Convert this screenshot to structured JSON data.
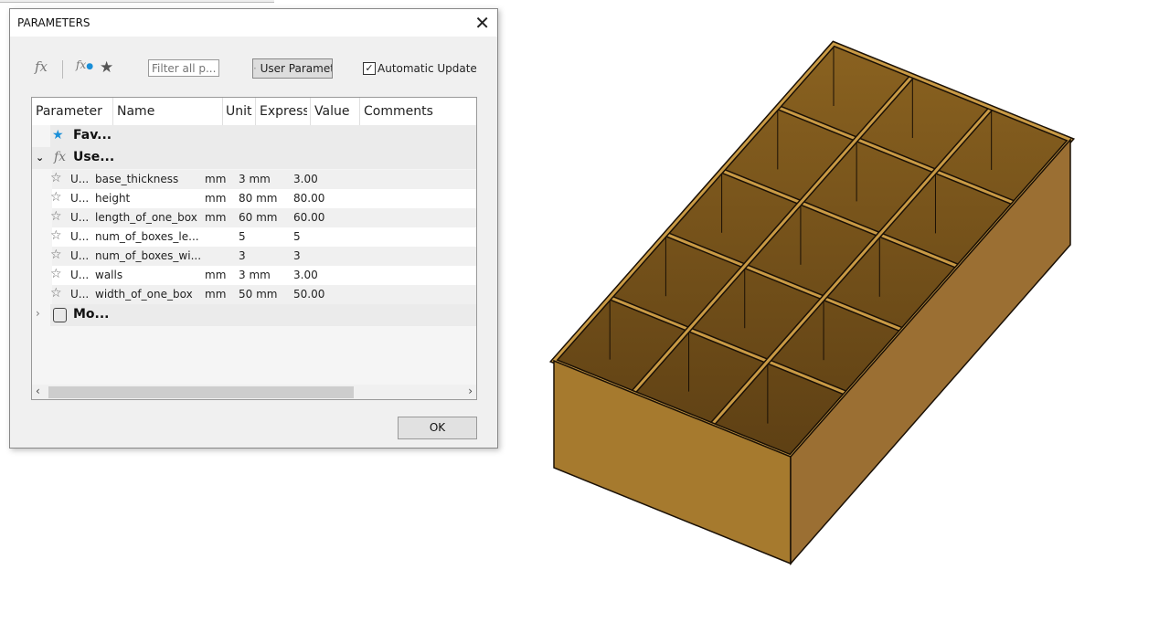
{
  "dialog": {
    "title": "PARAMETERS",
    "close_icon": "close-icon"
  },
  "toolbar": {
    "filter_placeholder": "Filter all p...",
    "user_param_button": "User Paramet",
    "auto_update_label": "Automatic Update",
    "auto_update_checked": true
  },
  "table": {
    "headers": [
      "Parameter",
      "Name",
      "Unit",
      "Express",
      "Value",
      "Comments"
    ],
    "groups": {
      "favorites": "Fav...",
      "user": "Use...",
      "model": "Mo..."
    },
    "rows": [
      {
        "type": "U...",
        "name": "base_thickness",
        "unit": "mm",
        "expression": "3 mm",
        "value": "3.00"
      },
      {
        "type": "U...",
        "name": "height",
        "unit": "mm",
        "expression": "80 mm",
        "value": "80.00"
      },
      {
        "type": "U...",
        "name": "length_of_one_box",
        "unit": "mm",
        "expression": "60 mm",
        "value": "60.00"
      },
      {
        "type": "U...",
        "name": "num_of_boxes_le...",
        "unit": "",
        "expression": "5",
        "value": "5"
      },
      {
        "type": "U...",
        "name": "num_of_boxes_wi...",
        "unit": "",
        "expression": "3",
        "value": "3"
      },
      {
        "type": "U...",
        "name": "walls",
        "unit": "mm",
        "expression": "3 mm",
        "value": "3.00"
      },
      {
        "type": "U...",
        "name": "width_of_one_box",
        "unit": "mm",
        "expression": "50 mm",
        "value": "50.00"
      }
    ]
  },
  "ok_button": "OK",
  "model": {
    "boxes_length": 5,
    "boxes_width": 3,
    "colors": {
      "front": "#a67a2e",
      "side": "#9b6f33",
      "rim": "#c99a45",
      "cell": "#5e4014",
      "edge": "#1a1005"
    }
  }
}
